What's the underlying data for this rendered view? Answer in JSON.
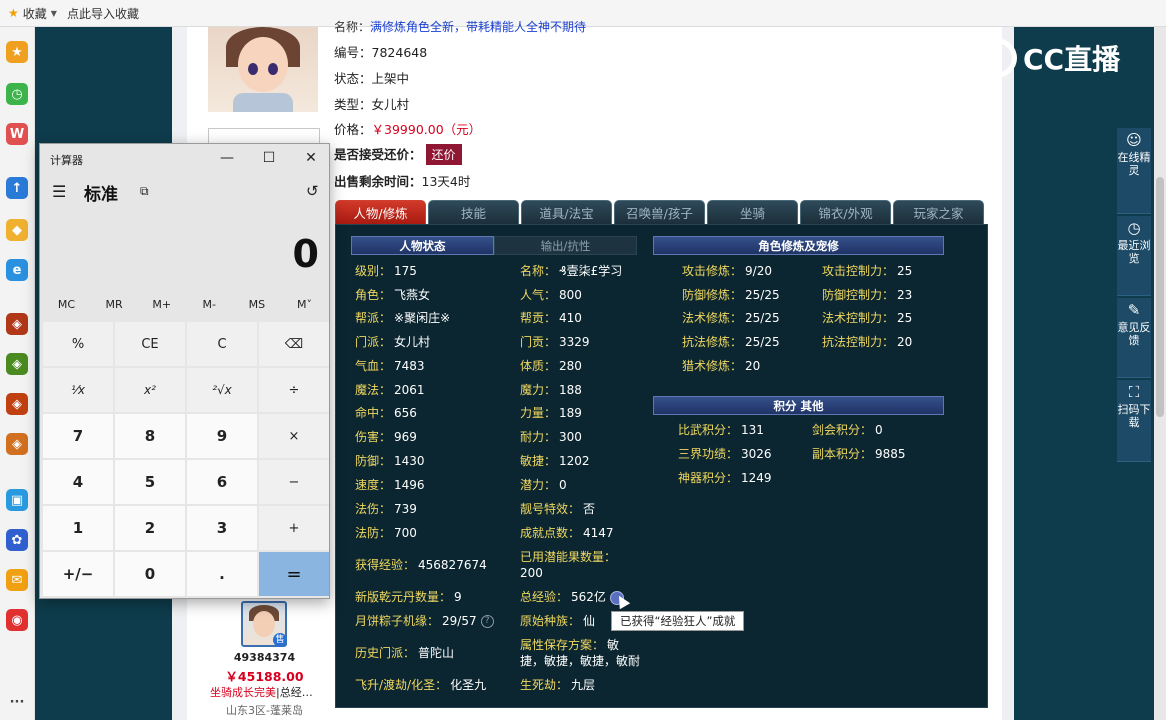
{
  "browser": {
    "bookmark_label": "收藏",
    "import_label": "点此导入收藏"
  },
  "item": {
    "top_truncated": "名称：",
    "top_truncated_blue": "满修炼角色全新，带耗精能人全神不期待",
    "number_label": "编号：",
    "number": "7824648",
    "status_label": "状态：",
    "status": "上架中",
    "type_label": "类型：",
    "type": "女儿村",
    "price_label": "价格：",
    "price": "￥39990.00（元）",
    "haggle_label": "是否接受还价：",
    "haggle_button": "还价",
    "remaining_label": "出售剩余时间：",
    "remaining": "13天4时"
  },
  "tabs": [
    "人物/修炼",
    "技能",
    "道具/法宝",
    "召唤兽/孩子",
    "坐骑",
    "锦衣/外观",
    "玩家之家"
  ],
  "panel": {
    "hdr_status": "人物状态",
    "hdr_output": "输出/抗性",
    "hdr_cultivation": "角色修炼及宠修",
    "hdr_points": "积分 其他",
    "col1": [
      {
        "k": "级别：",
        "v": "175"
      },
      {
        "k": "角色：",
        "v": "飞燕女"
      },
      {
        "k": "帮派：",
        "v": "※聚闲庄※"
      },
      {
        "k": "门派：",
        "v": "女儿村"
      },
      {
        "k": "气血：",
        "v": "7483"
      },
      {
        "k": "魔法：",
        "v": "2061"
      },
      {
        "k": "命中：",
        "v": "656"
      },
      {
        "k": "伤害：",
        "v": "969"
      },
      {
        "k": "防御：",
        "v": "1430"
      },
      {
        "k": "速度：",
        "v": "1496"
      },
      {
        "k": "法伤：",
        "v": "739"
      },
      {
        "k": "法防：",
        "v": "700"
      }
    ],
    "col2": [
      {
        "k": "名称：",
        "v": "₰壹柒£学习"
      },
      {
        "k": "人气：",
        "v": "800"
      },
      {
        "k": "帮贡：",
        "v": "410"
      },
      {
        "k": "门贡：",
        "v": "3329"
      },
      {
        "k": "体质：",
        "v": "280"
      },
      {
        "k": "魔力：",
        "v": "188"
      },
      {
        "k": "力量：",
        "v": "189"
      },
      {
        "k": "耐力：",
        "v": "300"
      },
      {
        "k": "敏捷：",
        "v": "1202"
      },
      {
        "k": "潜力：",
        "v": "0"
      },
      {
        "k": "靓号特效：",
        "v": "否"
      },
      {
        "k": "成就点数：",
        "v": "4147"
      }
    ],
    "col3": [
      {
        "k": "攻击修炼：",
        "v": "9/20"
      },
      {
        "k": "防御修炼：",
        "v": "25/25"
      },
      {
        "k": "法术修炼：",
        "v": "25/25"
      },
      {
        "k": "抗法修炼：",
        "v": "25/25"
      },
      {
        "k": "猎术修炼：",
        "v": "20"
      }
    ],
    "col4": [
      {
        "k": "攻击控制力：",
        "v": "25"
      },
      {
        "k": "防御控制力：",
        "v": "23"
      },
      {
        "k": "法术控制力：",
        "v": "25"
      },
      {
        "k": "抗法控制力：",
        "v": "20"
      }
    ],
    "points_left": [
      {
        "k": "比武积分：",
        "v": "131"
      },
      {
        "k": "三界功绩：",
        "v": "3026"
      },
      {
        "k": "神器积分：",
        "v": "1249"
      }
    ],
    "points_right": [
      {
        "k": "剑会积分：",
        "v": "0"
      },
      {
        "k": "副本积分：",
        "v": "9885"
      }
    ],
    "exp_label": "获得经验：",
    "exp": "456827674",
    "used_fruit_label": "已用潜能果数量：",
    "used_fruit": "200",
    "new_dan_label": "新版乾元丹数量：",
    "new_dan": "9",
    "total_exp_label": "总经验：",
    "total_exp": "562亿",
    "mooncake_label": "月饼粽子机缘：",
    "mooncake": "29/57",
    "origin_label": "原始种族：",
    "origin": "仙",
    "history_label": "历史门派：",
    "history": "普陀山",
    "attr_plan_label": "属性保存方案：",
    "attr_plan_1": "敏",
    "attr_plan_2": "捷，敏捷，敏捷，敏耐",
    "ascend_label": "飞升/渡劫/化圣：",
    "ascend": "化圣九",
    "life_label": "生死劫：",
    "life": "九层",
    "tooltip": "已获得“经验狂人”成就"
  },
  "seller": {
    "badge": "售",
    "id": "49384374",
    "price": "￥45188.00",
    "tag_red": "坐骑成长完美",
    "tag_sep": "|",
    "tag_black": "总经…",
    "server": "山东3区-蓬莱岛"
  },
  "calculator": {
    "title": "计算器",
    "mode": "标准",
    "display": "0",
    "memory": [
      "MC",
      "MR",
      "M+",
      "M-",
      "MS",
      "M˅"
    ],
    "keys": [
      "%",
      "CE",
      "C",
      "⌫",
      "¹⁄x",
      "x²",
      "²√x",
      "÷",
      "7",
      "8",
      "9",
      "×",
      "4",
      "5",
      "6",
      "−",
      "1",
      "2",
      "3",
      "+",
      "+/−",
      "0",
      ".",
      "="
    ]
  },
  "overlay": {
    "logo_text": "CC直播"
  },
  "right_tools": [
    {
      "label": "在线精灵"
    },
    {
      "label": "最近浏览"
    },
    {
      "label": "意见反馈"
    },
    {
      "label": "扫码下载"
    }
  ]
}
